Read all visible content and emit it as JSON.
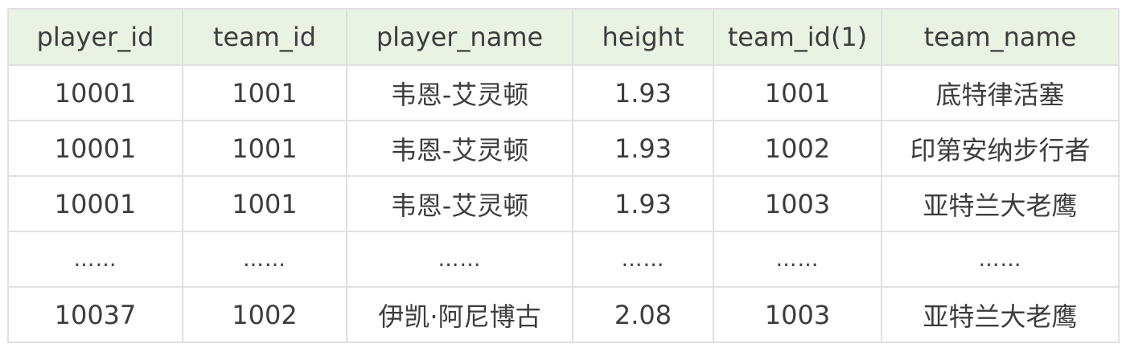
{
  "table": {
    "headers": [
      "player_id",
      "team_id",
      "player_name",
      "height",
      "team_id(1)",
      "team_name"
    ],
    "rows": [
      [
        "10001",
        "1001",
        "韦恩-艾灵顿",
        "1.93",
        "1001",
        "底特律活塞"
      ],
      [
        "10001",
        "1001",
        "韦恩-艾灵顿",
        "1.93",
        "1002",
        "印第安纳步行者"
      ],
      [
        "10001",
        "1001",
        "韦恩-艾灵顿",
        "1.93",
        "1003",
        "亚特兰大老鹰"
      ],
      [
        "……",
        "……",
        "……",
        "……",
        "……",
        "……"
      ],
      [
        "10037",
        "1002",
        "伊凯·阿尼博古",
        "2.08",
        "1003",
        "亚特兰大老鹰"
      ]
    ],
    "colors": {
      "header_background": "#e9f3e4",
      "border": "#dfe0df",
      "text": "#3d3d3d"
    }
  }
}
